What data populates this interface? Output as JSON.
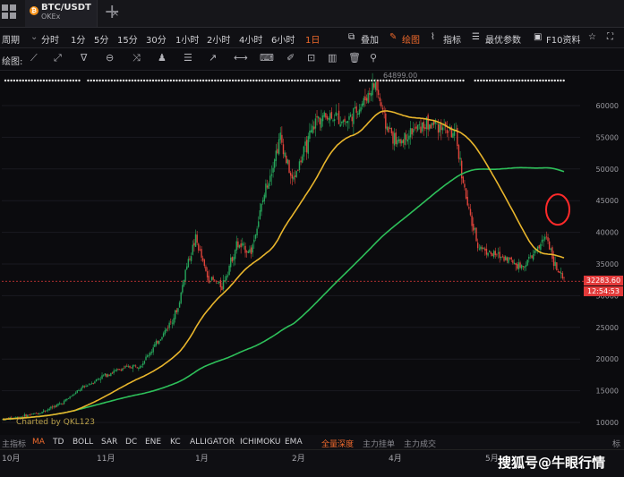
{
  "tab": {
    "symbol": "BTC/USDT",
    "exchange": "OKEx",
    "close": "×"
  },
  "new_tab": "+",
  "periods": {
    "label": "周期",
    "items": [
      "分时",
      "1分",
      "5分",
      "15分",
      "30分",
      "1小时",
      "2小时",
      "4小时",
      "6小时",
      "1日"
    ],
    "active": "1日"
  },
  "actions": [
    "叠加",
    "绘图",
    "指标",
    "最优参数",
    "F10资料"
  ],
  "drawing": {
    "label": "绘图:"
  },
  "chart_data": {
    "type": "candlestick",
    "symbol": "BTC/USDT",
    "y_ticks": [
      10000,
      15000,
      20000,
      25000,
      30000,
      35000,
      40000,
      45000,
      50000,
      55000,
      60000
    ],
    "x_ticks": [
      "10月",
      "11月",
      "1月",
      "2月",
      "4月",
      "5月"
    ],
    "last_price": "32283.60",
    "countdown": "12:54:53",
    "top_value": "64899.00",
    "annotation": "circle-at-ma-crossover",
    "colors": {
      "up": "#26a65b",
      "down": "#e0443b",
      "ma_fast": "#e8b52c",
      "ma_slow": "#2ec05a",
      "annotation": "#ff2a2a"
    }
  },
  "chart_credit": "Charted by QKL123",
  "indicators": {
    "items": [
      "主指标",
      "MA",
      "TD",
      "BOLL",
      "SAR",
      "DC",
      "ENE",
      "KC",
      "ALLIGATOR",
      "ICHIMOKU",
      "EMA",
      "全量深度",
      "主力挂单",
      "主力成交"
    ],
    "right_fragment": "标"
  },
  "watermark": "搜狐号@牛眼行情"
}
